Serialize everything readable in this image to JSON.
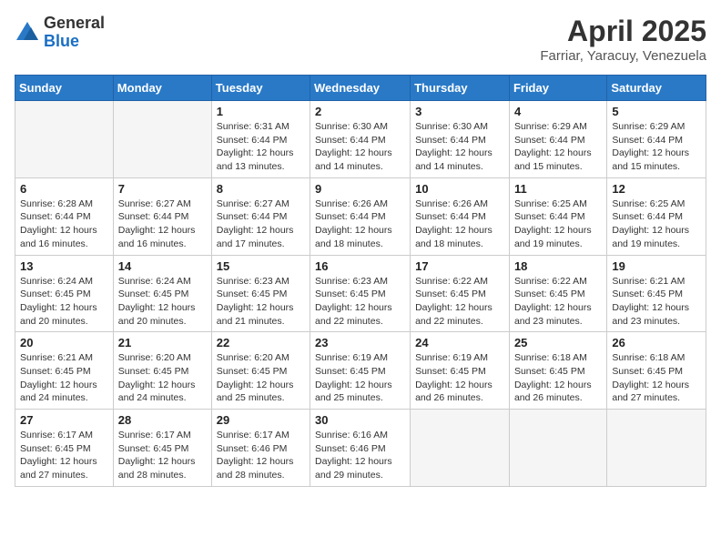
{
  "logo": {
    "general": "General",
    "blue": "Blue"
  },
  "title": "April 2025",
  "subtitle": "Farriar, Yaracuy, Venezuela",
  "weekdays": [
    "Sunday",
    "Monday",
    "Tuesday",
    "Wednesday",
    "Thursday",
    "Friday",
    "Saturday"
  ],
  "weeks": [
    [
      {
        "day": "",
        "sunrise": "",
        "sunset": "",
        "daylight": ""
      },
      {
        "day": "",
        "sunrise": "",
        "sunset": "",
        "daylight": ""
      },
      {
        "day": "1",
        "sunrise": "Sunrise: 6:31 AM",
        "sunset": "Sunset: 6:44 PM",
        "daylight": "Daylight: 12 hours and 13 minutes."
      },
      {
        "day": "2",
        "sunrise": "Sunrise: 6:30 AM",
        "sunset": "Sunset: 6:44 PM",
        "daylight": "Daylight: 12 hours and 14 minutes."
      },
      {
        "day": "3",
        "sunrise": "Sunrise: 6:30 AM",
        "sunset": "Sunset: 6:44 PM",
        "daylight": "Daylight: 12 hours and 14 minutes."
      },
      {
        "day": "4",
        "sunrise": "Sunrise: 6:29 AM",
        "sunset": "Sunset: 6:44 PM",
        "daylight": "Daylight: 12 hours and 15 minutes."
      },
      {
        "day": "5",
        "sunrise": "Sunrise: 6:29 AM",
        "sunset": "Sunset: 6:44 PM",
        "daylight": "Daylight: 12 hours and 15 minutes."
      }
    ],
    [
      {
        "day": "6",
        "sunrise": "Sunrise: 6:28 AM",
        "sunset": "Sunset: 6:44 PM",
        "daylight": "Daylight: 12 hours and 16 minutes."
      },
      {
        "day": "7",
        "sunrise": "Sunrise: 6:27 AM",
        "sunset": "Sunset: 6:44 PM",
        "daylight": "Daylight: 12 hours and 16 minutes."
      },
      {
        "day": "8",
        "sunrise": "Sunrise: 6:27 AM",
        "sunset": "Sunset: 6:44 PM",
        "daylight": "Daylight: 12 hours and 17 minutes."
      },
      {
        "day": "9",
        "sunrise": "Sunrise: 6:26 AM",
        "sunset": "Sunset: 6:44 PM",
        "daylight": "Daylight: 12 hours and 18 minutes."
      },
      {
        "day": "10",
        "sunrise": "Sunrise: 6:26 AM",
        "sunset": "Sunset: 6:44 PM",
        "daylight": "Daylight: 12 hours and 18 minutes."
      },
      {
        "day": "11",
        "sunrise": "Sunrise: 6:25 AM",
        "sunset": "Sunset: 6:44 PM",
        "daylight": "Daylight: 12 hours and 19 minutes."
      },
      {
        "day": "12",
        "sunrise": "Sunrise: 6:25 AM",
        "sunset": "Sunset: 6:44 PM",
        "daylight": "Daylight: 12 hours and 19 minutes."
      }
    ],
    [
      {
        "day": "13",
        "sunrise": "Sunrise: 6:24 AM",
        "sunset": "Sunset: 6:45 PM",
        "daylight": "Daylight: 12 hours and 20 minutes."
      },
      {
        "day": "14",
        "sunrise": "Sunrise: 6:24 AM",
        "sunset": "Sunset: 6:45 PM",
        "daylight": "Daylight: 12 hours and 20 minutes."
      },
      {
        "day": "15",
        "sunrise": "Sunrise: 6:23 AM",
        "sunset": "Sunset: 6:45 PM",
        "daylight": "Daylight: 12 hours and 21 minutes."
      },
      {
        "day": "16",
        "sunrise": "Sunrise: 6:23 AM",
        "sunset": "Sunset: 6:45 PM",
        "daylight": "Daylight: 12 hours and 22 minutes."
      },
      {
        "day": "17",
        "sunrise": "Sunrise: 6:22 AM",
        "sunset": "Sunset: 6:45 PM",
        "daylight": "Daylight: 12 hours and 22 minutes."
      },
      {
        "day": "18",
        "sunrise": "Sunrise: 6:22 AM",
        "sunset": "Sunset: 6:45 PM",
        "daylight": "Daylight: 12 hours and 23 minutes."
      },
      {
        "day": "19",
        "sunrise": "Sunrise: 6:21 AM",
        "sunset": "Sunset: 6:45 PM",
        "daylight": "Daylight: 12 hours and 23 minutes."
      }
    ],
    [
      {
        "day": "20",
        "sunrise": "Sunrise: 6:21 AM",
        "sunset": "Sunset: 6:45 PM",
        "daylight": "Daylight: 12 hours and 24 minutes."
      },
      {
        "day": "21",
        "sunrise": "Sunrise: 6:20 AM",
        "sunset": "Sunset: 6:45 PM",
        "daylight": "Daylight: 12 hours and 24 minutes."
      },
      {
        "day": "22",
        "sunrise": "Sunrise: 6:20 AM",
        "sunset": "Sunset: 6:45 PM",
        "daylight": "Daylight: 12 hours and 25 minutes."
      },
      {
        "day": "23",
        "sunrise": "Sunrise: 6:19 AM",
        "sunset": "Sunset: 6:45 PM",
        "daylight": "Daylight: 12 hours and 25 minutes."
      },
      {
        "day": "24",
        "sunrise": "Sunrise: 6:19 AM",
        "sunset": "Sunset: 6:45 PM",
        "daylight": "Daylight: 12 hours and 26 minutes."
      },
      {
        "day": "25",
        "sunrise": "Sunrise: 6:18 AM",
        "sunset": "Sunset: 6:45 PM",
        "daylight": "Daylight: 12 hours and 26 minutes."
      },
      {
        "day": "26",
        "sunrise": "Sunrise: 6:18 AM",
        "sunset": "Sunset: 6:45 PM",
        "daylight": "Daylight: 12 hours and 27 minutes."
      }
    ],
    [
      {
        "day": "27",
        "sunrise": "Sunrise: 6:17 AM",
        "sunset": "Sunset: 6:45 PM",
        "daylight": "Daylight: 12 hours and 27 minutes."
      },
      {
        "day": "28",
        "sunrise": "Sunrise: 6:17 AM",
        "sunset": "Sunset: 6:45 PM",
        "daylight": "Daylight: 12 hours and 28 minutes."
      },
      {
        "day": "29",
        "sunrise": "Sunrise: 6:17 AM",
        "sunset": "Sunset: 6:46 PM",
        "daylight": "Daylight: 12 hours and 28 minutes."
      },
      {
        "day": "30",
        "sunrise": "Sunrise: 6:16 AM",
        "sunset": "Sunset: 6:46 PM",
        "daylight": "Daylight: 12 hours and 29 minutes."
      },
      {
        "day": "",
        "sunrise": "",
        "sunset": "",
        "daylight": ""
      },
      {
        "day": "",
        "sunrise": "",
        "sunset": "",
        "daylight": ""
      },
      {
        "day": "",
        "sunrise": "",
        "sunset": "",
        "daylight": ""
      }
    ]
  ]
}
